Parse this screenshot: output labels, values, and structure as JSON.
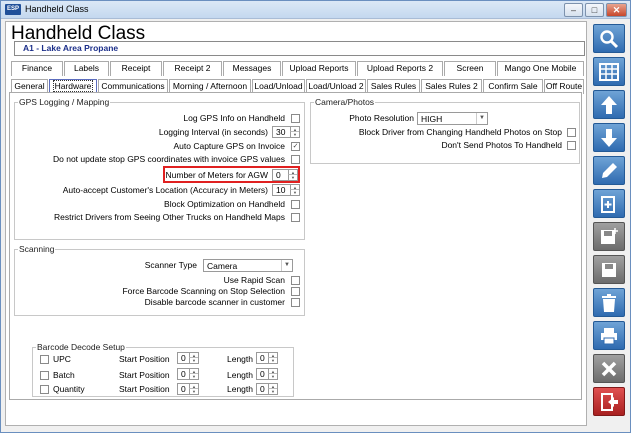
{
  "window": {
    "title": "Handheld Class",
    "icon_text": "ESP"
  },
  "header": {
    "title": "Handheld Class",
    "location": "A1 - Lake Area Propane"
  },
  "tabs_row1": [
    "Finance",
    "Labels",
    "Receipt",
    "Receipt 2",
    "Messages",
    "Upload Reports",
    "Upload Reports 2",
    "Screen",
    "Mango One Mobile"
  ],
  "tabs_row2": [
    "General",
    "Hardware",
    "Communications",
    "Morning / Afternoon",
    "Load/Unload",
    "Load/Unload 2",
    "Sales Rules",
    "Sales Rules 2",
    "Confirm Sale",
    "Off Route"
  ],
  "active_tab": "Hardware",
  "gps": {
    "title": "GPS Logging / Mapping",
    "log_gps": "Log GPS Info on Handheld",
    "logging_interval": "Logging Interval (in seconds)",
    "logging_interval_value": "30",
    "auto_capture": "Auto Capture GPS on Invoice",
    "do_not_update": "Do not update stop GPS coordinates with invoice GPS values",
    "meters_agw": "Number of Meters for AGW",
    "meters_agw_value": "0",
    "auto_accept": "Auto-accept Customer's Location (Accuracy in Meters)",
    "auto_accept_value": "10",
    "block_optimization": "Block Optimization on Handheld",
    "restrict_drivers": "Restrict Drivers from Seeing Other Trucks on Handheld Maps"
  },
  "camera": {
    "title": "Camera/Photos",
    "resolution_label": "Photo Resolution",
    "resolution_value": "HIGH",
    "block_changing": "Block Driver from Changing Handheld Photos on Stop",
    "dont_send": "Don't Send Photos To Handheld"
  },
  "scanning": {
    "title": "Scanning",
    "scanner_type_label": "Scanner Type",
    "scanner_type_value": "Camera",
    "use_rapid": "Use Rapid Scan",
    "force_barcode": "Force Barcode Scanning on Stop Selection",
    "disable_scanner": "Disable barcode scanner in customer"
  },
  "barcode": {
    "title": "Barcode Decode Setup",
    "start_label": "Start Position",
    "length_label": "Length",
    "rows": [
      {
        "name": "UPC",
        "start": "0",
        "length": "0"
      },
      {
        "name": "Batch",
        "start": "0",
        "length": "0"
      },
      {
        "name": "Quantity",
        "start": "0",
        "length": "0"
      }
    ]
  },
  "sidebar_icons": [
    "search-icon",
    "grid-icon",
    "arrow-up-icon",
    "arrow-down-icon",
    "pencil-icon",
    "new-document-icon",
    "save-new-icon",
    "save-icon",
    "trash-icon",
    "print-icon",
    "close-icon",
    "exit-icon"
  ],
  "colors": {
    "accent": "#2f6bb0",
    "highlight": "#e02020",
    "location_text": "#1c2f8a"
  }
}
